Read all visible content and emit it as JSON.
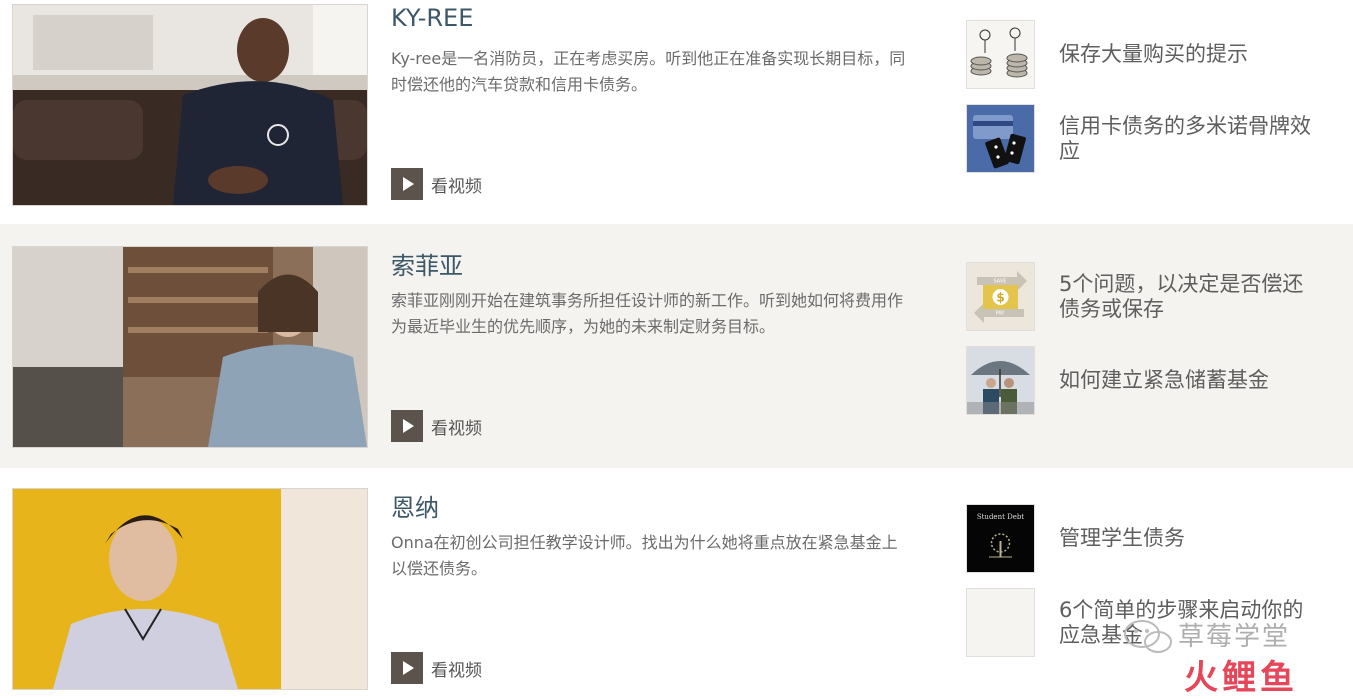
{
  "rows": [
    {
      "title": "KY-REE",
      "description": "Ky-ree是一名消防员，正在考虑买房。听到他正在准备实现长期目标，同时偿还他的汽车贷款和信用卡债务。",
      "watch_label": "看视频",
      "related": [
        {
          "label": "保存大量购买的提示",
          "icon": "coins-people-icon"
        },
        {
          "label": "信用卡债务的多米诺骨牌效应",
          "icon": "dominoes-card-icon"
        }
      ]
    },
    {
      "title": "索菲亚",
      "description": "索菲亚刚刚开始在建筑事务所担任设计师的新工作。听到她如何将费用作为最近毕业生的优先顺序，为她的未来制定财务目标。",
      "watch_label": "看视频",
      "related": [
        {
          "label": "5个问题，以决定是否偿还债务或保存",
          "icon": "save-pay-dollar-icon",
          "icon_text_top": "SAVE",
          "icon_text_bottom": "PAY"
        },
        {
          "label": "如何建立紧急储蓄基金",
          "icon": "umbrella-couple-icon"
        }
      ]
    },
    {
      "title": "恩纳",
      "description": "Onna在初创公司担任教学设计师。找出为什么她将重点放在紧急基金上以偿还债务。",
      "watch_label": "看视频",
      "related": [
        {
          "label": "管理学生债务",
          "icon": "student-debt-tree-icon",
          "icon_text": "Student Debt"
        },
        {
          "label": "6个简单的步骤来启动你的应急基金",
          "icon": "blank-thumbnail-icon"
        }
      ]
    }
  ],
  "watermark": {
    "line1": "草莓学堂",
    "line2": "火鲤鱼"
  },
  "colors": {
    "title": "#3c5867",
    "play_button": "#5b534c",
    "row_alt_bg": "#f5f3f0"
  }
}
